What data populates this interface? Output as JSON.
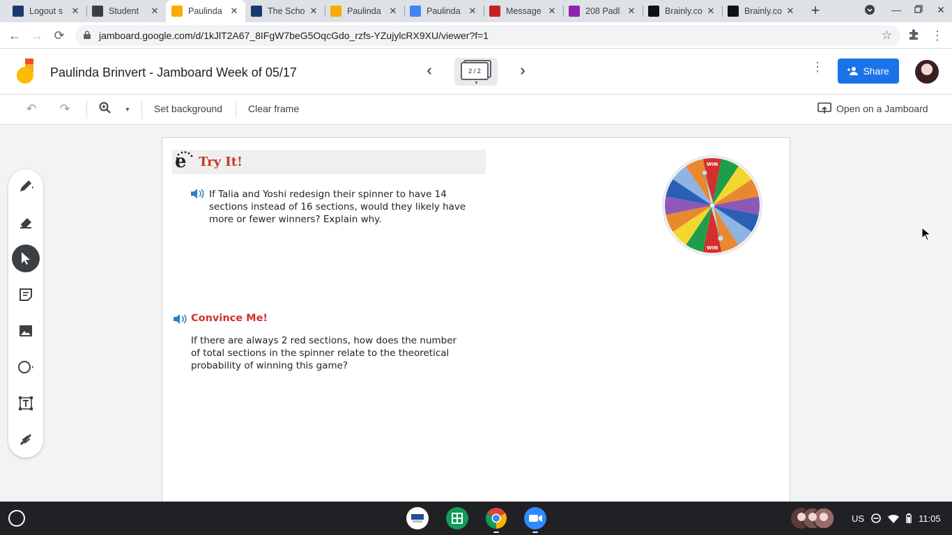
{
  "browser": {
    "tabs": [
      {
        "label": "Logout s",
        "favicon": "graduation-cap",
        "color": "#1a3a6e",
        "active": false
      },
      {
        "label": "Student",
        "favicon": "contact-card",
        "color": "#3c4043",
        "active": false
      },
      {
        "label": "Paulinda",
        "favicon": "jamboard",
        "color": "#f9ab00",
        "active": true
      },
      {
        "label": "The Scho",
        "favicon": "graduation-cap",
        "color": "#1a3a6e",
        "active": false
      },
      {
        "label": "Paulinda",
        "favicon": "jamboard",
        "color": "#f9ab00",
        "active": false
      },
      {
        "label": "Paulinda",
        "favicon": "docs",
        "color": "#4285f4",
        "active": false
      },
      {
        "label": "Message",
        "favicon": "quizlet",
        "color": "#c5221f",
        "active": false
      },
      {
        "label": "208 Padl",
        "favicon": "padlet",
        "color": "#8e24aa",
        "active": false
      },
      {
        "label": "Brainly.co",
        "favicon": "brainly",
        "color": "#111111",
        "active": false
      },
      {
        "label": "Brainly.co",
        "favicon": "brainly",
        "color": "#111111",
        "active": false
      }
    ],
    "url": "jamboard.google.com/d/1kJlT2A67_8IFgW7beG5OqcGdo_rzfs-YZujylcRX9XU/viewer?f=1"
  },
  "app": {
    "title": "Paulinda Brinvert - Jamboard Week of 05/17",
    "frame_indicator": "2 / 2",
    "share_label": "Share",
    "toolbar": {
      "set_background": "Set background",
      "clear_frame": "Clear frame",
      "open_on_jamboard": "Open on a Jamboard"
    },
    "tools": [
      "pen-icon",
      "eraser-icon",
      "select-icon",
      "sticky-note-icon",
      "image-icon",
      "circle-icon",
      "text-box-icon",
      "laser-icon"
    ],
    "active_tool": "select-icon"
  },
  "frame_content": {
    "tryit_logo": "e",
    "tryit_title": "Try It!",
    "question1": "If Talia and Yoshi redesign their spinner to have 14 sections instead of 16 sections, would they likely have more or fewer winners? Explain why.",
    "convince_title": "Convince Me!",
    "question2": "If there are always 2 red sections, how does the number of total sections in the spinner relate to the theoretical probability of winning this game?",
    "spinner_label_top": "WIN",
    "spinner_label_bottom": "WIN"
  },
  "shelf": {
    "apps": [
      "pearson-app-icon",
      "sheets-icon",
      "chrome-icon",
      "zoom-icon"
    ],
    "keyboard_layout": "US",
    "time": "11:05"
  }
}
